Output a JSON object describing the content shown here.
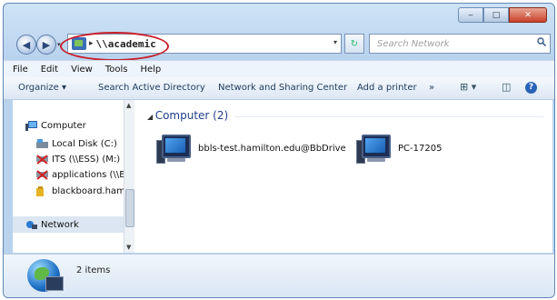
{
  "window": {
    "caption_buttons": {
      "minimize": "‒",
      "maximize": "□",
      "close": "✕"
    }
  },
  "nav": {
    "back_icon": "back-arrow-icon",
    "forward_icon": "forward-arrow-icon",
    "address_separator": "▸",
    "address_value": "\\\\academic",
    "address_dropdown": "▾",
    "refresh": "↻",
    "search_placeholder": "Search Network"
  },
  "menubar": [
    "File",
    "Edit",
    "View",
    "Tools",
    "Help"
  ],
  "toolbar": {
    "organize": "Organize ▾",
    "search_ad": "Search Active Directory",
    "network_sharing": "Network and Sharing Center",
    "add_printer": "Add a printer",
    "more": "»",
    "view_options": "⊞ ▾",
    "preview_pane": "◫",
    "help": "?"
  },
  "navpane": {
    "computer": "Computer",
    "items": [
      {
        "label": "Local Disk (C:)",
        "icon": "drive-icon",
        "color": "#6b7b8d"
      },
      {
        "label": "ITS (\\\\ESS) (M:)",
        "icon": "network-drive-icon",
        "color": "#c0392b"
      },
      {
        "label": "applications (\\\\E",
        "icon": "network-drive-icon",
        "color": "#c0392b"
      },
      {
        "label": "blackboard.hami",
        "icon": "folder-icon",
        "color": "#e6b422"
      }
    ],
    "network": "Network"
  },
  "content": {
    "group_title": "Computer (2)",
    "items": [
      {
        "name": "bbls-test.hamilton.edu@BbDrive"
      },
      {
        "name": "PC-17205"
      }
    ]
  },
  "details": {
    "count": "2 items"
  },
  "colors": {
    "highlight_circle": "#c8202a",
    "group_title": "#1e3f8a"
  }
}
